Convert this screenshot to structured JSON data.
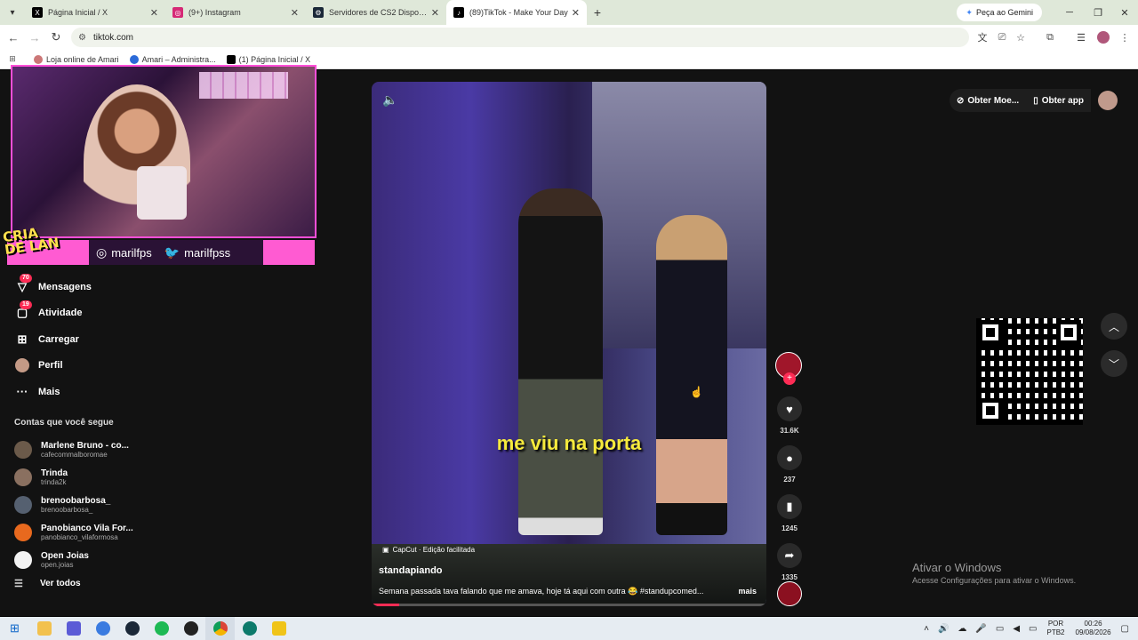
{
  "browser": {
    "tabs": [
      {
        "title": "Página Inicial / X",
        "icon": "x-logo-icon",
        "active": false
      },
      {
        "title": "(9+) Instagram",
        "icon": "instagram-icon",
        "active": false
      },
      {
        "title": "Servidores de CS2 Disponíveis",
        "icon": "steam-icon",
        "active": false
      },
      {
        "title": "(89)TikTok - Make Your Day",
        "icon": "tiktok-icon",
        "active": true
      }
    ],
    "gemini_label": "Peça ao Gemini",
    "url": "tiktok.com",
    "bookmarks": [
      "Loja online de Amari",
      "Amari – Administra...",
      "(1) Página Inicial / X"
    ]
  },
  "overlay": {
    "logo_line1": "CRIA",
    "logo_line2": "DE LAN",
    "instagram_handle": "marilfps",
    "twitter_handle": "marilfpss"
  },
  "sidebar": {
    "nav": [
      {
        "label": "Mensagens",
        "icon": "messages-icon",
        "badge": "70"
      },
      {
        "label": "Atividade",
        "icon": "activity-icon",
        "badge": "19"
      },
      {
        "label": "Carregar",
        "icon": "upload-icon",
        "badge": ""
      },
      {
        "label": "Perfil",
        "icon": "profile-avatar",
        "badge": ""
      },
      {
        "label": "Mais",
        "icon": "more-icon",
        "badge": ""
      }
    ],
    "following_title": "Contas que você segue",
    "following": [
      {
        "name": "Marlene Bruno - co...",
        "handle": "cafecommalboromae",
        "color": "#6b5a4a"
      },
      {
        "name": "Trinda",
        "handle": "trinda2k",
        "color": "#8a7060"
      },
      {
        "name": "brenoobarbosa_",
        "handle": "brenoobarbosa_",
        "color": "#556070"
      },
      {
        "name": "Panobianco Vila For...",
        "handle": "panobianco_vilaformosa",
        "color": "#e8691e"
      },
      {
        "name": "Open Joias",
        "handle": "open.joias",
        "color": "#f2f2f2"
      }
    ],
    "see_all": "Ver todos"
  },
  "video": {
    "caption": "me viu na porta",
    "capcut": "CapCut · Edição facilitada",
    "author": "standapiando",
    "description": "Semana passada tava falando que me amava, hoje tá aqui com outra 😂 #standupcomed...",
    "more": "mais",
    "progress": 0.07
  },
  "actions": {
    "likes": "31.6K",
    "comments": "237",
    "saves": "1245",
    "shares": "1335"
  },
  "topbar": {
    "coins": "Obter Moe...",
    "app": "Obter app"
  },
  "watermark": {
    "line1": "Ativar o Windows",
    "line2": "Acesse Configurações para ativar o Windows."
  },
  "tray": {
    "lang1": "POR",
    "lang2": "PTB2",
    "time": "00:26",
    "date": "09/08/2026"
  }
}
